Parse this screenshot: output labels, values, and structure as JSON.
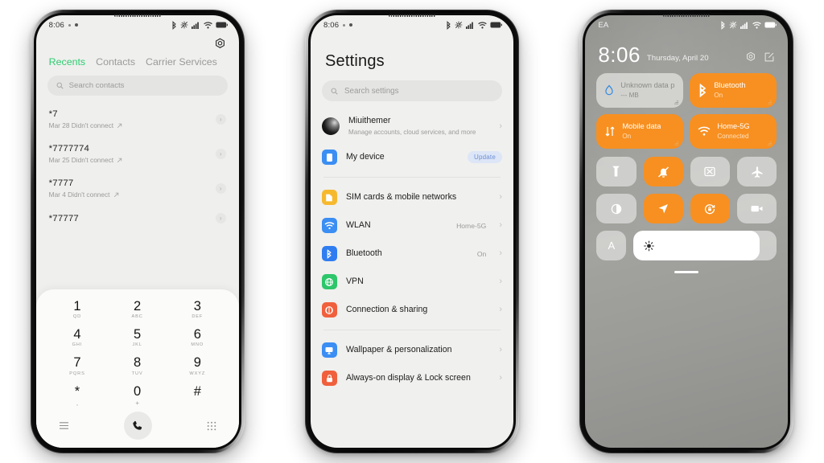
{
  "phone1": {
    "name": "dialer-phone",
    "statusbar": {
      "time": "8:06",
      "icons": [
        "bluetooth-icon",
        "vibrate-icon",
        "signal-icon",
        "wifi-icon",
        "battery-icon"
      ]
    },
    "settings_icon": "gear-icon",
    "tabs": [
      {
        "label": "Recents",
        "active": true
      },
      {
        "label": "Contacts",
        "active": false
      },
      {
        "label": "Carrier Services",
        "active": false
      }
    ],
    "search": {
      "placeholder": "Search contacts",
      "icon": "search-icon"
    },
    "calls": [
      {
        "number": "*7",
        "detail": "Mar 28 Didn't connect"
      },
      {
        "number": "*7777774",
        "detail": "Mar 25 Didn't connect"
      },
      {
        "number": "*7777",
        "detail": "Mar 4 Didn't connect"
      },
      {
        "number": "*77777",
        "detail": ""
      }
    ],
    "keypad": [
      {
        "digit": "1",
        "letters": "QD"
      },
      {
        "digit": "2",
        "letters": "ABC"
      },
      {
        "digit": "3",
        "letters": "DEF"
      },
      {
        "digit": "4",
        "letters": "GHI"
      },
      {
        "digit": "5",
        "letters": "JKL"
      },
      {
        "digit": "6",
        "letters": "MNO"
      },
      {
        "digit": "7",
        "letters": "PQRS"
      },
      {
        "digit": "8",
        "letters": "TUV"
      },
      {
        "digit": "9",
        "letters": "WXYZ"
      },
      {
        "digit": "*",
        "letters": ","
      },
      {
        "digit": "0",
        "letters": "+"
      },
      {
        "digit": "#",
        "letters": ""
      }
    ],
    "actions": {
      "menu": "menu-icon",
      "call": "call-icon",
      "keypad": "keypad-icon"
    }
  },
  "phone2": {
    "name": "settings-phone",
    "statusbar": {
      "time": "8:06"
    },
    "title": "Settings",
    "search": {
      "placeholder": "Search settings",
      "icon": "search-icon"
    },
    "account": {
      "name": "Miuithemer",
      "desc": "Manage accounts, cloud services, and more",
      "avatar": "user-avatar"
    },
    "items": [
      {
        "label": "My device",
        "value": "",
        "badge": "Update",
        "icon": "device-icon",
        "color": "#3b8ef3",
        "chevron": false
      },
      {
        "label": "SIM cards & mobile networks",
        "value": "",
        "badge": "",
        "icon": "sim-icon",
        "color": "#f6b92e",
        "chevron": true
      },
      {
        "label": "WLAN",
        "value": "Home-5G",
        "badge": "",
        "icon": "wifi-icon",
        "color": "#3b8ef3",
        "chevron": true
      },
      {
        "label": "Bluetooth",
        "value": "On",
        "badge": "",
        "icon": "bluetooth-icon",
        "color": "#2f7df0",
        "chevron": true
      },
      {
        "label": "VPN",
        "value": "",
        "badge": "",
        "icon": "globe-icon",
        "color": "#2dc66a",
        "chevron": true
      },
      {
        "label": "Connection & sharing",
        "value": "",
        "badge": "",
        "icon": "share-icon",
        "color": "#f0603c",
        "chevron": true
      },
      {
        "label": "Wallpaper & personalization",
        "value": "",
        "badge": "",
        "icon": "wallpaper-icon",
        "color": "#3b8ef3",
        "chevron": true
      },
      {
        "label": "Always-on display & Lock screen",
        "value": "",
        "badge": "",
        "icon": "lock-icon",
        "color": "#f0603c",
        "chevron": true
      }
    ]
  },
  "phone3": {
    "name": "control-center-phone",
    "statusbar": {
      "carrier": "EA",
      "time": ""
    },
    "clock": {
      "time": "8:06",
      "date": "Thursday, April 20"
    },
    "head_icons": [
      "gear-icon",
      "edit-icon"
    ],
    "big_tiles": [
      {
        "title": "Unknown data plan",
        "sub": "--- MB",
        "state": "off",
        "icon": "data-drop-icon"
      },
      {
        "title": "Bluetooth",
        "sub": "On",
        "state": "on",
        "icon": "bluetooth-icon"
      },
      {
        "title": "Mobile data",
        "sub": "On",
        "state": "on",
        "icon": "mobile-data-icon"
      },
      {
        "title": "Home-5G",
        "sub": "Connected",
        "state": "on",
        "icon": "wifi-icon"
      }
    ],
    "toggles": [
      {
        "icon": "flashlight-icon",
        "state": "off"
      },
      {
        "icon": "silent-icon",
        "state": "on"
      },
      {
        "icon": "screenshot-icon",
        "state": "off"
      },
      {
        "icon": "airplane-icon",
        "state": "off"
      },
      {
        "icon": "dark-mode-icon",
        "state": "off"
      },
      {
        "icon": "location-icon",
        "state": "on"
      },
      {
        "icon": "rotation-lock-icon",
        "state": "on"
      },
      {
        "icon": "screen-record-icon",
        "state": "off"
      }
    ],
    "auto_brightness": {
      "label": "A",
      "state": "off"
    },
    "brightness": {
      "icon": "sun-icon",
      "level": 88
    },
    "accent_color": "#f79021"
  }
}
